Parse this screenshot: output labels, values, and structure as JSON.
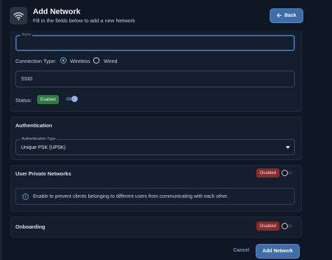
{
  "header": {
    "icon": "wifi-icon",
    "title": "Add Network",
    "subtitle": "Fill in the fields below to add a new Network",
    "back_label": "Back",
    "back_icon": "arrow-left-icon"
  },
  "general": {
    "name_label": "Name",
    "name_value": "",
    "connection_type_label": "Connection Type:",
    "connection_options": [
      "Wireless",
      "Wired"
    ],
    "connection_selected": "Wireless",
    "ssid_placeholder": "SSID",
    "status_label": "Status:",
    "status_badge": "Enabled",
    "status_on": true
  },
  "authentication": {
    "title": "Authentication",
    "type_label": "Authentication Type",
    "type_value": "Unique PSK (UPSK)"
  },
  "user_private_networks": {
    "title": "User Private Networks",
    "badge": "Disabled",
    "enabled": false,
    "info_icon": "info-icon",
    "info_text": "Enable to prevent clients belonging to different users from communicating with each other."
  },
  "onboarding": {
    "title": "Onboarding",
    "badge": "Disabled",
    "enabled": false
  },
  "footer": {
    "cancel_label": "Cancel",
    "submit_label": "Add Network"
  },
  "colors": {
    "background": "#0f1724",
    "card": "#141e2c",
    "accent": "#3e6ea9",
    "enabled_badge": "#2f7a45",
    "disabled_badge": "#8a2b2b"
  }
}
